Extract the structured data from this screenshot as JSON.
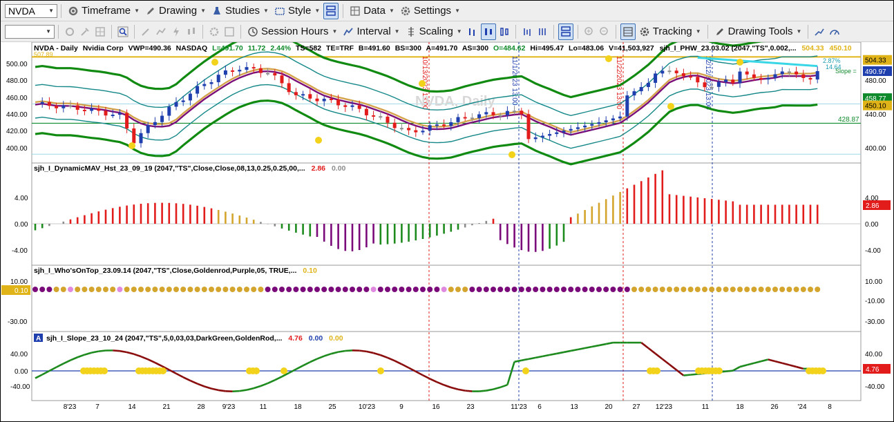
{
  "toolbar1": {
    "symbol": "NVDA",
    "timeframe": "Timeframe",
    "drawing": "Drawing",
    "studies": "Studies",
    "style": "Style",
    "data": "Data",
    "settings": "Settings"
  },
  "toolbar2": {
    "session_hours": "Session Hours",
    "interval": "Interval",
    "scaling": "Scaling",
    "tracking": "Tracking",
    "drawing_tools": "Drawing Tools"
  },
  "main_pane": {
    "header": {
      "symbol": "NVDA - Daily",
      "name": "Nvidia Corp",
      "vwp": "VWP=490.36",
      "exchange": "NASDAQ",
      "last": "L=491.70",
      "chg": "11.72",
      "pct": "2.44%",
      "ts": "TS=582",
      "te": "TE=TRF",
      "bid": "B=491.60",
      "bs": "BS=300",
      "ask": "A=491.70",
      "as": "AS=300",
      "open": "O=484.62",
      "hi": "Hi=495.47",
      "lo": "Lo=483.06",
      "vol": "V=41,503,927",
      "study": "sjh_I_PHW_23.03.02 (2047,\"TS\",0.002,...",
      "v1": "504.33",
      "v2": "450.10"
    },
    "watermark": "NVDA, Daily",
    "cut_label": "507.89",
    "pct_label": "2.87%",
    "val_label": "14.64",
    "slope_label": "Slope =",
    "axis_ticks": [
      "500.00",
      "480.00",
      "460.00",
      "440.00",
      "420.00",
      "400.00"
    ],
    "right_ticks": [
      "480.00",
      "440.00",
      "400.00"
    ],
    "hline_label": "428.87",
    "badges": [
      {
        "text": "504.33",
        "bg": "#e0b418",
        "fg": "#000000"
      },
      {
        "text": "490.97",
        "bg": "#1f3fae",
        "fg": "#ffffff"
      },
      {
        "text": "458.77",
        "bg": "#0f8a2a",
        "fg": "#ffffff"
      },
      {
        "text": "450.10",
        "bg": "#e0b418",
        "fg": "#000000"
      }
    ],
    "vline_labels": [
      "10/13/2023 13:00",
      "11/1/2023 13:00",
      "11/22/2023 13:00",
      "12/12/2023 13:00"
    ]
  },
  "dynmav_pane": {
    "title": "sjh_I_DynamicMAV_Hst_23_09_19 (2047,\"TS\",Close,Close,08,13,0.25,0.25,00,...",
    "v1": "2.86",
    "v2": "0.00",
    "ticks": [
      "4.00",
      "0.00",
      "-4.00"
    ],
    "badge": "2.86"
  },
  "whos_pane": {
    "title": "sjh_I_Who'sOnTop_23.09.14 (2047,\"TS\",Close,Goldenrod,Purple,05, TRUE,...",
    "v1": "0.10",
    "ticks": [
      "10.00",
      "-10.00",
      "-30.00"
    ],
    "badge": "0.10"
  },
  "slope_pane": {
    "a_label": "A",
    "title": "sjh_I_Slope_23_10_24 (2047,\"TS\",5,0,03,03,DarkGreen,GoldenRod,...",
    "v1": "4.76",
    "v2": "0.00",
    "v3": "0.00",
    "ticks": [
      "40.00",
      "0.00",
      "-40.00"
    ],
    "badge": "4.76"
  },
  "time_axis": [
    "8'23",
    "7",
    "14",
    "21",
    "28",
    "9'23",
    "11",
    "18",
    "25",
    "10'23",
    "9",
    "16",
    "23",
    "11'23",
    "6",
    "13",
    "20",
    "27",
    "12'23",
    "11",
    "18",
    "26",
    "'24",
    "8"
  ],
  "colors": {
    "up": "#1f3fae",
    "down": "#e21b1b",
    "neutral": "#8c8c8c",
    "band_outer": "#118a11",
    "band_inner": "#138787",
    "avg_gold": "#d4a24a",
    "avg_purple": "#7a0f7a",
    "gold": "#d4a52c",
    "purple": "#7a0a7a",
    "green": "#1d8a1d",
    "slope_up": "#1d8a1d",
    "slope_dn": "#8a0d0d",
    "yellow": "#f2d21b"
  }
}
